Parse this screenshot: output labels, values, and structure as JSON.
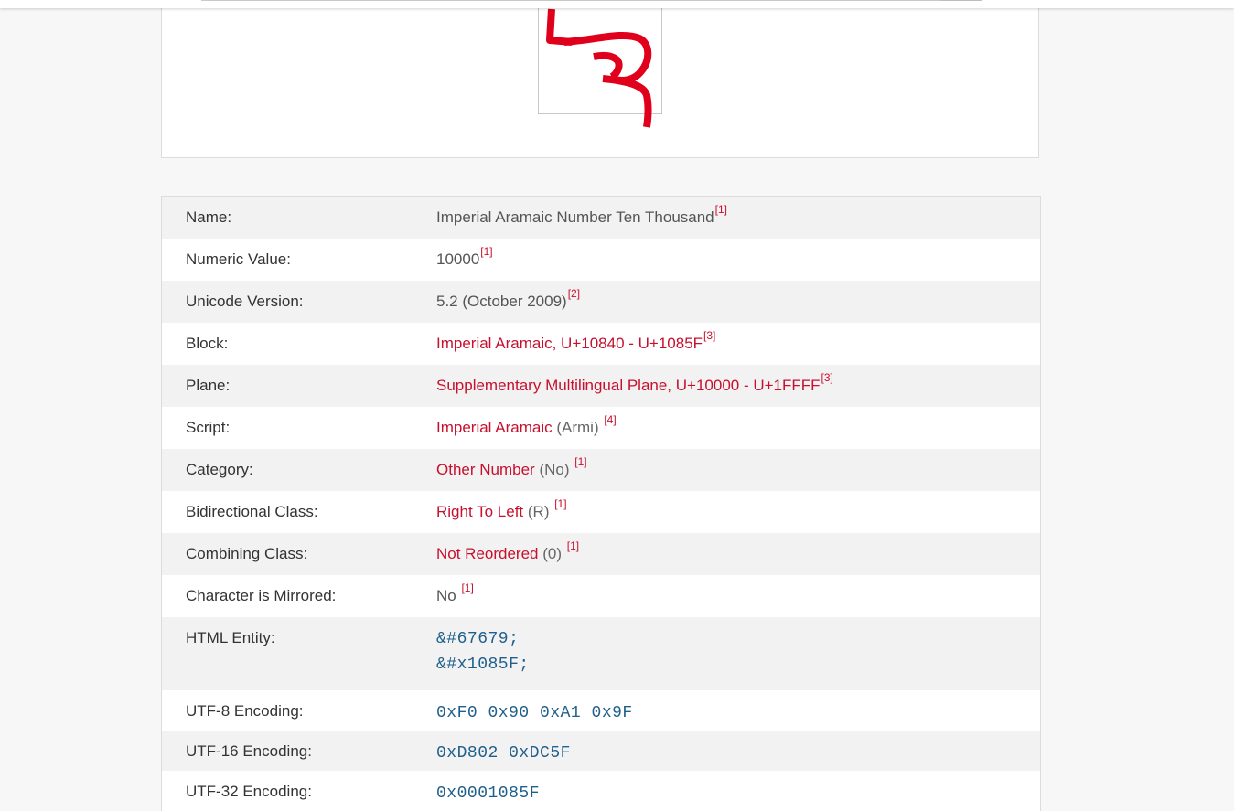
{
  "colors": {
    "accent": "#c8102e",
    "code": "#1f5f8b",
    "row_alt": "#f2f2f2"
  },
  "glyph": {
    "icon": "imperial-aramaic-ten-thousand-glyph",
    "color": "#e0001b"
  },
  "properties": [
    {
      "label": "Name:",
      "value": "Imperial Aramaic Number Ten Thousand",
      "ref": "[1]"
    },
    {
      "label": "Numeric Value:",
      "value": "10000",
      "ref": "[1]"
    },
    {
      "label": "Unicode Version:",
      "value": "5.2 (October 2009)",
      "ref": "[2]"
    },
    {
      "label": "Block:",
      "link": "Imperial Aramaic, U+10840 - U+1085F",
      "ref": "[3]"
    },
    {
      "label": "Plane:",
      "link": "Supplementary Multilingual Plane, U+10000 - U+1FFFF",
      "ref": "[3]"
    },
    {
      "label": "Script:",
      "link": "Imperial Aramaic",
      "suffix": "(Armi)",
      "ref": "[4]"
    },
    {
      "label": "Category:",
      "link": "Other Number",
      "suffix": "(No)",
      "ref": "[1]"
    },
    {
      "label": "Bidirectional Class:",
      "link": "Right To Left",
      "suffix": "(R)",
      "ref": "[1]"
    },
    {
      "label": "Combining Class:",
      "link": "Not Reordered",
      "suffix": "(0)",
      "ref": "[1]"
    },
    {
      "label": "Character is Mirrored:",
      "value": "No",
      "ref": "[1]"
    },
    {
      "label": "HTML Entity:",
      "code_lines": [
        "&#67679;",
        "&#x1085F;"
      ]
    },
    {
      "label": "UTF-8 Encoding:",
      "code": "0xF0 0x90 0xA1 0x9F"
    },
    {
      "label": "UTF-16 Encoding:",
      "code": "0xD802 0xDC5F"
    },
    {
      "label": "UTF-32 Encoding:",
      "code": "0x0001085F"
    }
  ]
}
